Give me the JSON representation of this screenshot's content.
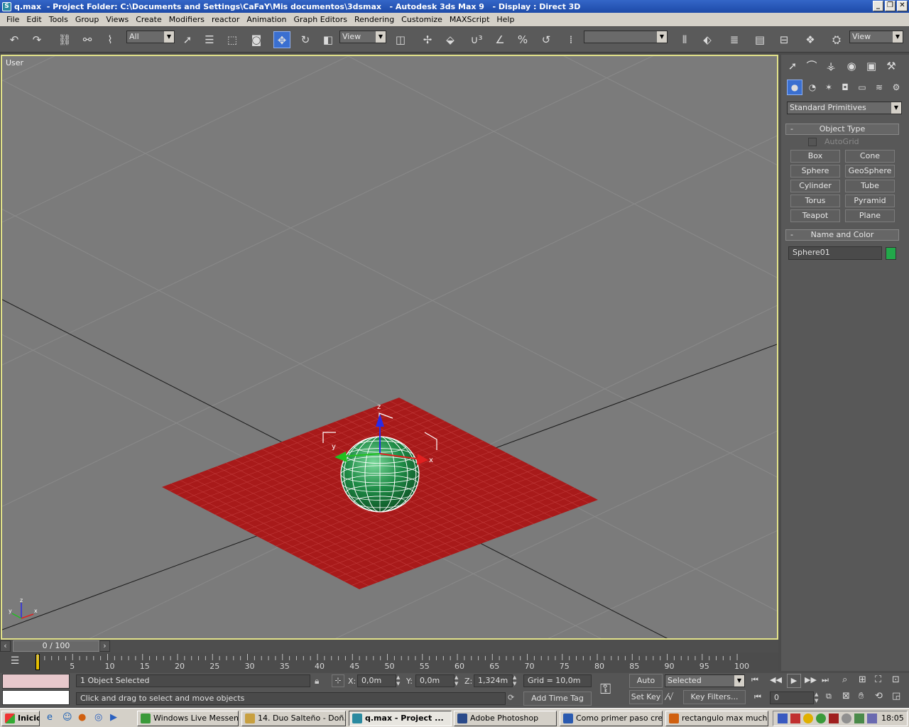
{
  "window": {
    "app_file": "q.max",
    "project": "  - Project Folder: C:\\Documents and Settings\\CaFaY\\Mis documentos\\3dsmax",
    "app": "   - Autodesk 3ds Max 9",
    "display": "   - Display : Direct 3D"
  },
  "menu": [
    "File",
    "Edit",
    "Tools",
    "Group",
    "Views",
    "Create",
    "Modifiers",
    "reactor",
    "Animation",
    "Graph Editors",
    "Rendering",
    "Customize",
    "MAXScript",
    "Help"
  ],
  "toolbar": {
    "selection_filter": "All",
    "ref_coord": "View",
    "named_sel": "",
    "render_view": "View"
  },
  "viewport": {
    "label": "User",
    "gizmo_x": "x",
    "gizmo_y": "y",
    "gizmo_z": "z",
    "axis_x": "x",
    "axis_y": "y",
    "axis_z": "z"
  },
  "command_panel": {
    "category": "Standard Primitives",
    "object_type_title": "Object Type",
    "autogrid": "AutoGrid",
    "buttons": [
      "Box",
      "Cone",
      "Sphere",
      "GeoSphere",
      "Cylinder",
      "Tube",
      "Torus",
      "Pyramid",
      "Teapot",
      "Plane"
    ],
    "name_color_title": "Name and Color",
    "object_name": "Sphere01",
    "object_color": "#22a84a"
  },
  "timeline": {
    "frame_display": "0 / 100",
    "ticks": [
      "5",
      "10",
      "15",
      "20",
      "25",
      "30",
      "35",
      "40",
      "45",
      "50",
      "55",
      "60",
      "65",
      "70",
      "75",
      "80",
      "85",
      "90",
      "95",
      "100"
    ]
  },
  "status": {
    "selection": "1 Object Selected",
    "prompt": "Click and drag to select and move objects",
    "x_label": "X:",
    "x_value": "0,0m",
    "y_label": "Y:",
    "y_value": "0,0m",
    "z_label": "Z:",
    "z_value": "1,324m",
    "grid": "Grid = 10,0m",
    "add_time_tag": "Add Time Tag",
    "auto_key": "Auto Key",
    "set_key": "Set Key",
    "key_mode": "Selected",
    "key_filters": "Key Filters...",
    "current_frame": "0"
  },
  "taskbar": {
    "start": "Inicio",
    "tasks": [
      "Windows Live Messen...",
      "14. Duo Salteño - Doñ...",
      "q.max    - Project ...",
      "Adobe Photoshop",
      "Como primer paso cre...",
      "rectangulo max much..."
    ],
    "clock": "18:05"
  },
  "colors": {
    "plane": "#a81a1a",
    "sphere": "#1e8c46",
    "viewport_bg": "#7b7b7b",
    "viewport_border": "#e2e28a"
  }
}
